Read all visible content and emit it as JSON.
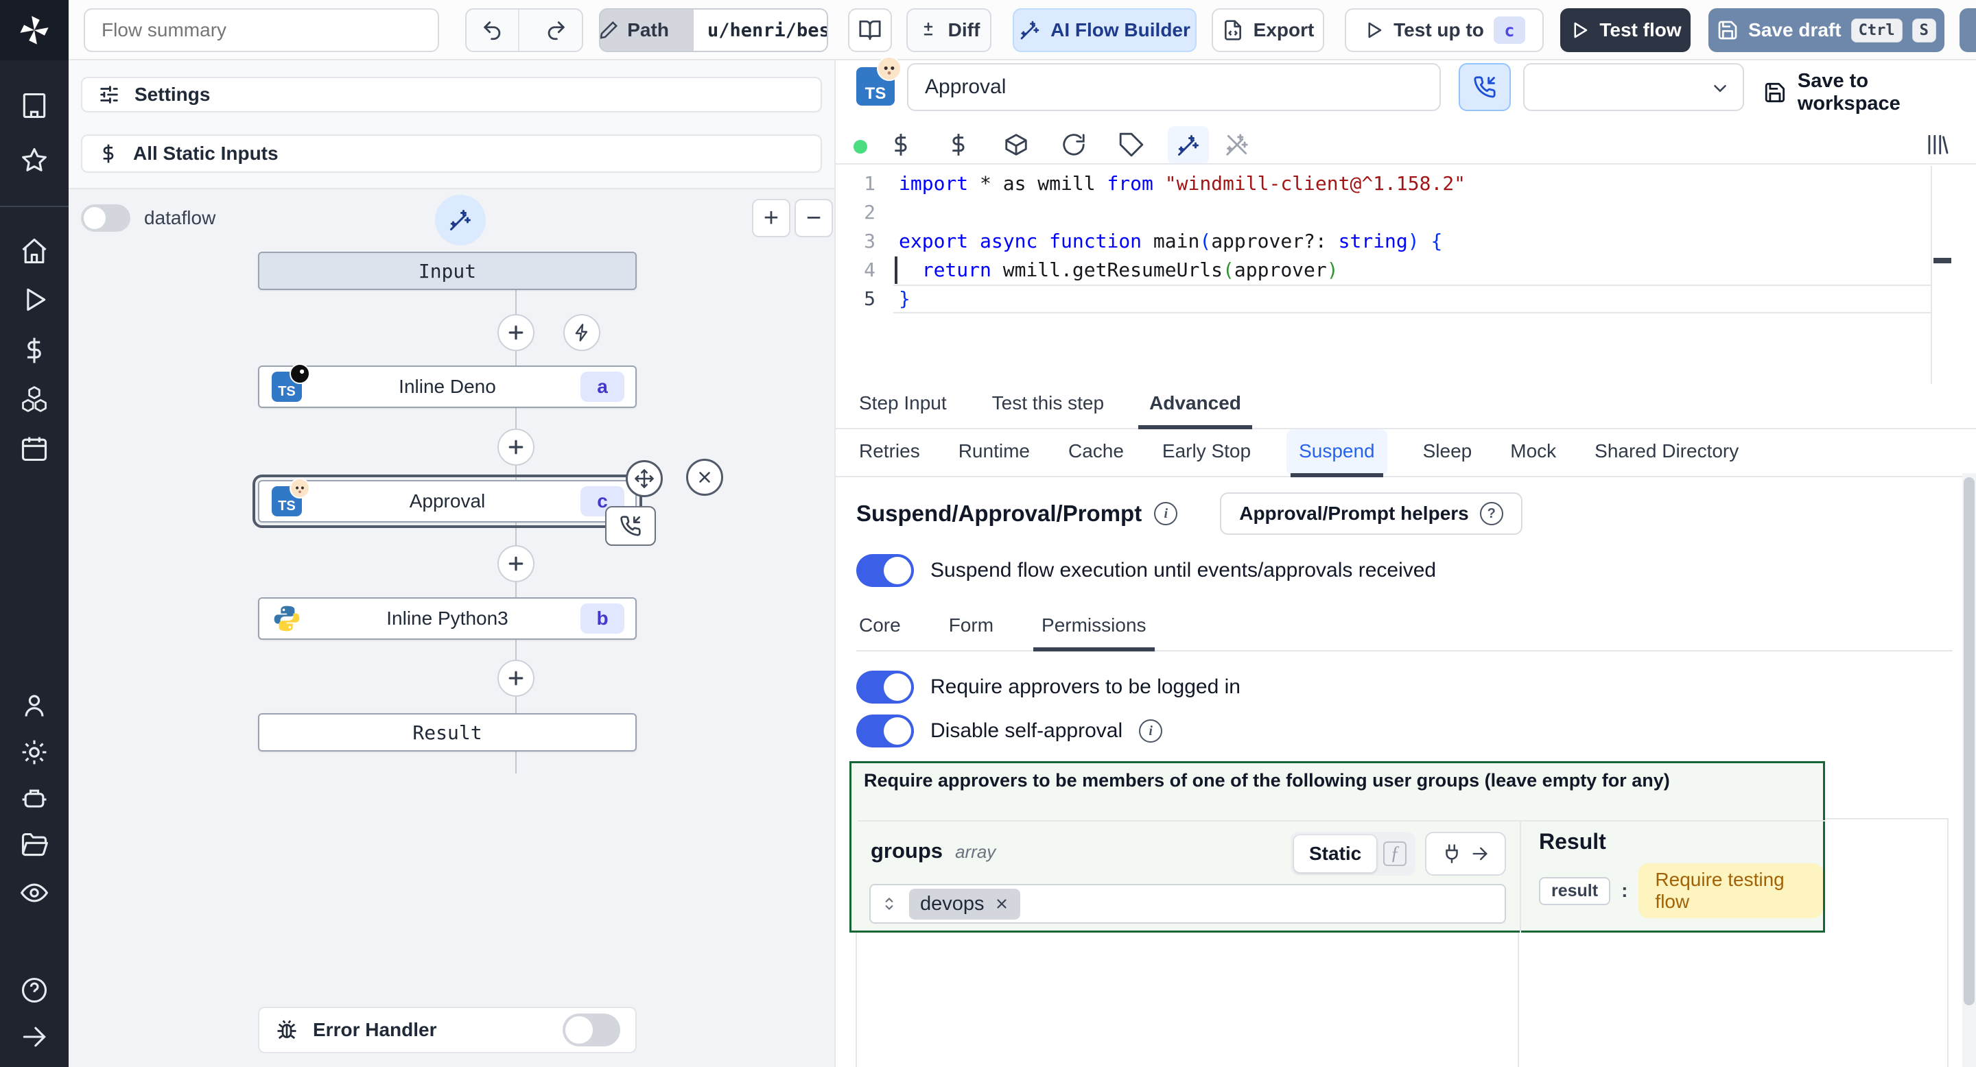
{
  "topbar": {
    "flow_summary_placeholder": "Flow summary",
    "path_label": "Path",
    "path_value": "u/henri/bes",
    "diff_label": "Diff",
    "ai_flow_builder_label": "AI Flow Builder",
    "export_label": "Export",
    "test_up_to_label": "Test up to",
    "test_up_to_badge": "c",
    "test_flow_label": "Test flow",
    "save_draft_label": "Save draft",
    "kbd_ctrl": "Ctrl",
    "kbd_s": "S"
  },
  "sidebar": {
    "icons": [
      "windmill-logo",
      "workspace-building",
      "favorites-star",
      "home",
      "runs-play",
      "variables-dollar",
      "resources-cubes",
      "schedules-calendar",
      "users-person",
      "settings-gear",
      "workers-robot",
      "folders",
      "audit-logs-eye",
      "help-question",
      "collapse-arrow-right"
    ]
  },
  "left_panel": {
    "settings_label": "Settings",
    "static_inputs_label": "All Static Inputs",
    "dataflow_label": "dataflow",
    "graph": {
      "input_label": "Input",
      "node_deno": {
        "label": "Inline Deno",
        "badge": "a"
      },
      "node_approval": {
        "label": "Approval",
        "badge": "c"
      },
      "node_python": {
        "label": "Inline Python3",
        "badge": "b"
      },
      "result_label": "Result"
    },
    "error_handler_label": "Error Handler"
  },
  "right_panel": {
    "step_name_value": "Approval",
    "save_to_workspace_label": "Save to workspace",
    "editor": {
      "line_numbers": [
        "1",
        "2",
        "3",
        "4",
        "5"
      ],
      "lines": [
        [
          {
            "t": "import",
            "c": "kw"
          },
          {
            "t": " * as wmill ",
            "c": "pl"
          },
          {
            "t": "from",
            "c": "kw"
          },
          {
            "t": " ",
            "c": "pl"
          },
          {
            "t": "\"windmill-client@^1.158.2\"",
            "c": "str"
          }
        ],
        [],
        [
          {
            "t": "export",
            "c": "kw"
          },
          {
            "t": " ",
            "c": "pl"
          },
          {
            "t": "async",
            "c": "kw"
          },
          {
            "t": " ",
            "c": "pl"
          },
          {
            "t": "function",
            "c": "kw"
          },
          {
            "t": " main",
            "c": "pl"
          },
          {
            "t": "(",
            "c": "b1"
          },
          {
            "t": "approver?: ",
            "c": "pl"
          },
          {
            "t": "string",
            "c": "kw"
          },
          {
            "t": ")",
            "c": "b1"
          },
          {
            "t": " ",
            "c": "pl"
          },
          {
            "t": "{",
            "c": "b1"
          }
        ],
        [
          {
            "t": "  ",
            "c": "pl"
          },
          {
            "t": "return",
            "c": "kw"
          },
          {
            "t": " wmill.getResumeUrls",
            "c": "pl"
          },
          {
            "t": "(",
            "c": "b2"
          },
          {
            "t": "approver",
            "c": "pl"
          },
          {
            "t": ")",
            "c": "b2"
          }
        ],
        [
          {
            "t": "}",
            "c": "b1"
          }
        ]
      ]
    },
    "tabs": {
      "items": [
        "Step Input",
        "Test this step",
        "Advanced"
      ],
      "active": 2
    },
    "subtabs": {
      "items": [
        "Retries",
        "Runtime",
        "Cache",
        "Early Stop",
        "Suspend",
        "Sleep",
        "Mock",
        "Shared Directory"
      ],
      "active": 4
    },
    "suspend": {
      "heading": "Suspend/Approval/Prompt",
      "helpers_button_label": "Approval/Prompt helpers",
      "suspend_toggle_label": "Suspend flow execution until events/approvals received",
      "inner_tabs": {
        "items": [
          "Core",
          "Form",
          "Permissions"
        ],
        "active": 2
      },
      "require_login_label": "Require approvers to be logged in",
      "disable_self_approval_label": "Disable self-approval",
      "groups_box": {
        "title": "Require approvers to be members of one of the following user groups (leave empty for any)",
        "field_name": "groups",
        "field_type": "array",
        "static_label": "Static",
        "fx_label": "ƒ",
        "tag": "devops",
        "result_title": "Result",
        "result_key": "result",
        "result_value": "Require testing flow"
      }
    }
  },
  "colors": {
    "toggle_on": "#3b5fe6",
    "test_flow_bg": "#2d3444",
    "save_draft_bg": "#6e88ac",
    "ai_builder_bg": "#dbeafe",
    "ai_builder_text": "#1e3a8a",
    "step_badge_bg": "#e0e7ff",
    "step_badge_text": "#4338ca",
    "suspend_tab_active": "#2563eb",
    "green_box_border": "#166534",
    "green_box_bg": "#f3f8f3",
    "result_badge_bg": "#fdf4bf",
    "result_badge_text": "#a16207",
    "code_keyword": "#0000ff",
    "code_string": "#a31515",
    "bracket_level1": "#0431fa",
    "bracket_level2": "#319331",
    "status_dot": "#4ade80"
  }
}
